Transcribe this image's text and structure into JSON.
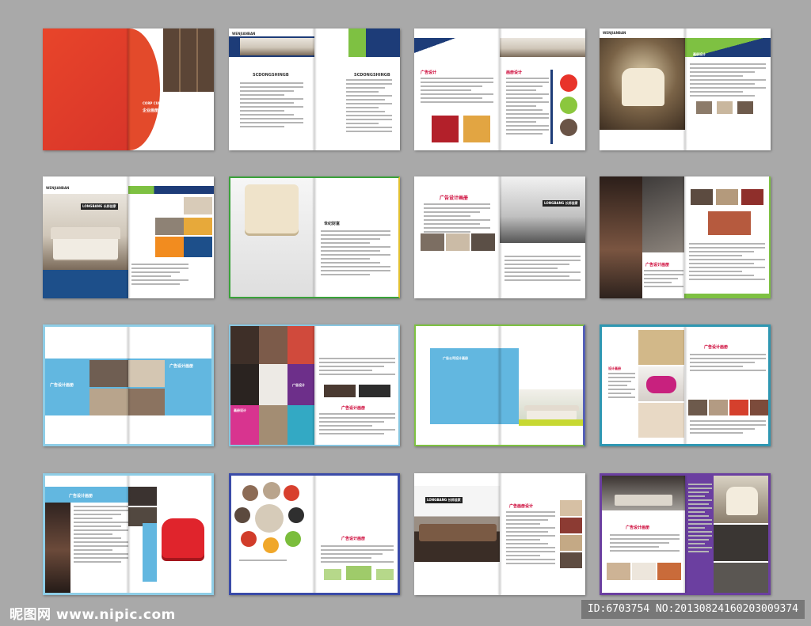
{
  "spreads": {
    "s1": {
      "title": "画册",
      "subtitle": "企业画册整体方案",
      "en": "CORP CULTURE BRO CHURE DESIGN"
    },
    "s2": {
      "brand": "WENJIANBAN",
      "heading_left": "SCDONGSHINGB",
      "heading_right": "SCDONGSHINGB"
    },
    "s3": {
      "heading_left": "广告设计",
      "heading_right": "画册设计"
    },
    "s4": {
      "brand": "WENJIANBAN",
      "tag": "画册设计"
    },
    "s5": {
      "brand": "WENJIANBAN",
      "sign": "LONGBANG 长邦佳家"
    },
    "s6": {
      "heading": "世纪财富"
    },
    "s7": {
      "heading": "广告设计画册",
      "sign": "LONGBANG 长邦佳家"
    },
    "s8": {
      "heading": "广告设计画册"
    },
    "s9": {
      "heading_left": "广告设计画册",
      "heading_right": "广告设计画册"
    },
    "s10": {
      "tag_left": "画册设计",
      "tag_mid": "广告设计",
      "heading": "广告设计画册"
    },
    "s11": {
      "heading": "广告公司设计画册"
    },
    "s12": {
      "heading": "广告设计画册",
      "tag": "设计画册"
    },
    "s13": {
      "heading": "广告设计画册"
    },
    "s14": {
      "heading": "广告设计画册"
    },
    "s15": {
      "heading": "广告画册设计",
      "sign": "LONGBANG 长邦佳家"
    },
    "s16": {
      "heading": "广告设计画册"
    }
  },
  "watermark": {
    "site": "昵图网 www.nipic.com",
    "id": "ID:6703754 NO:20130824160203009374"
  }
}
